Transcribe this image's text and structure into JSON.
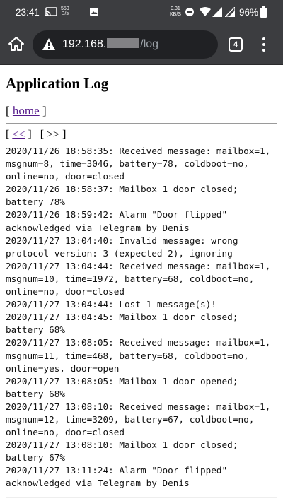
{
  "status_bar": {
    "time": "23:41",
    "net_speed_value": "550",
    "net_speed_unit": "B/s",
    "rate_value": "0.31",
    "rate_unit": "KB/S",
    "battery": "96%"
  },
  "browser": {
    "url_host_prefix": "192.168.",
    "url_path": "/log",
    "tab_count": "4"
  },
  "page": {
    "title": "Application Log",
    "nav_open": "[ ",
    "nav_home": "home",
    "nav_close": " ]",
    "pager_prev_open": "[ ",
    "pager_prev": "<<",
    "pager_prev_close": " ]   [ >> ]"
  },
  "log_lines": [
    "2020/11/26 18:58:35: Received message: mailbox=1,",
    "msgnum=8, time=3046, battery=78, coldboot=no,",
    "online=no, door=closed",
    "2020/11/26 18:58:37: Mailbox 1 door closed;",
    "battery 78%",
    "2020/11/26 18:59:42: Alarm \"Door flipped\"",
    "acknowledged via Telegram by Denis",
    "2020/11/27 13:04:40: Invalid message: wrong",
    "protocol version: 3 (expected 2), ignoring",
    "2020/11/27 13:04:44: Received message: mailbox=1,",
    "msgnum=10, time=1972, battery=68, coldboot=no,",
    "online=no, door=closed",
    "2020/11/27 13:04:44: Lost 1 message(s)!",
    "2020/11/27 13:04:45: Mailbox 1 door closed;",
    "battery 68%",
    "2020/11/27 13:08:05: Received message: mailbox=1,",
    "msgnum=11, time=468, battery=68, coldboot=no,",
    "online=yes, door=open",
    "2020/11/27 13:08:05: Mailbox 1 door opened;",
    "battery 68%",
    "2020/11/27 13:08:10: Received message: mailbox=1,",
    "msgnum=12, time=3209, battery=67, coldboot=no,",
    "online=no, door=closed",
    "2020/11/27 13:08:10: Mailbox 1 door closed;",
    "battery 67%",
    "2020/11/27 13:11:24: Alarm \"Door flipped\"",
    "acknowledged via Telegram by Denis"
  ]
}
